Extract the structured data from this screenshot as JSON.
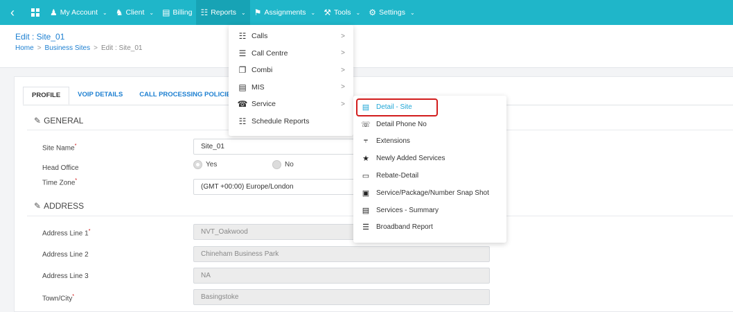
{
  "nav": {
    "items": [
      {
        "label": "My Account",
        "icon": "user-icon",
        "dropdown": true
      },
      {
        "label": "Client",
        "icon": "users-icon",
        "dropdown": true
      },
      {
        "label": "Billing",
        "icon": "billing-icon",
        "dropdown": false
      },
      {
        "label": "Reports",
        "icon": "chart-icon",
        "dropdown": true,
        "active": true
      },
      {
        "label": "Assignments",
        "icon": "assign-icon",
        "dropdown": true
      },
      {
        "label": "Tools",
        "icon": "tools-icon",
        "dropdown": true
      },
      {
        "label": "Settings",
        "icon": "gear-icon",
        "dropdown": true
      }
    ]
  },
  "page": {
    "title": "Edit : Site_01",
    "breadcrumb": [
      "Home",
      "Business Sites",
      "Edit : Site_01"
    ]
  },
  "tabs": [
    "PROFILE",
    "VOIP DETAILS",
    "CALL PROCESSING POLICIES"
  ],
  "general": {
    "heading": "GENERAL",
    "site_name_label": "Site Name",
    "site_name_value": "Site_01",
    "head_office_label": "Head Office",
    "head_office_yes": "Yes",
    "head_office_no": "No",
    "time_zone_label": "Time Zone",
    "time_zone_value": "(GMT +00:00) Europe/London"
  },
  "address": {
    "heading": "ADDRESS",
    "line1_label": "Address Line 1",
    "line1_value": "NVT_Oakwood",
    "line2_label": "Address Line 2",
    "line2_value": "Chineham Business Park",
    "line3_label": "Address Line 3",
    "line3_value": "NA",
    "town_label": "Town/City",
    "town_value": "Basingstoke"
  },
  "reports_menu": {
    "items": [
      "Calls",
      "Call Centre",
      "Combi",
      "MIS",
      "Service",
      "Schedule Reports"
    ]
  },
  "service_submenu": {
    "items": [
      "Detail - Site",
      "Detail Phone No",
      "Extensions",
      "Newly Added Services",
      "Rebate-Detail",
      "Service/Package/Number Snap Shot",
      "Services - Summary",
      "Broadband Report"
    ]
  },
  "colors": {
    "nav_bg": "#1fb6c9",
    "link": "#1c7fd1",
    "selected_item": "#1fa6d6",
    "highlight": "#d21c1c"
  }
}
